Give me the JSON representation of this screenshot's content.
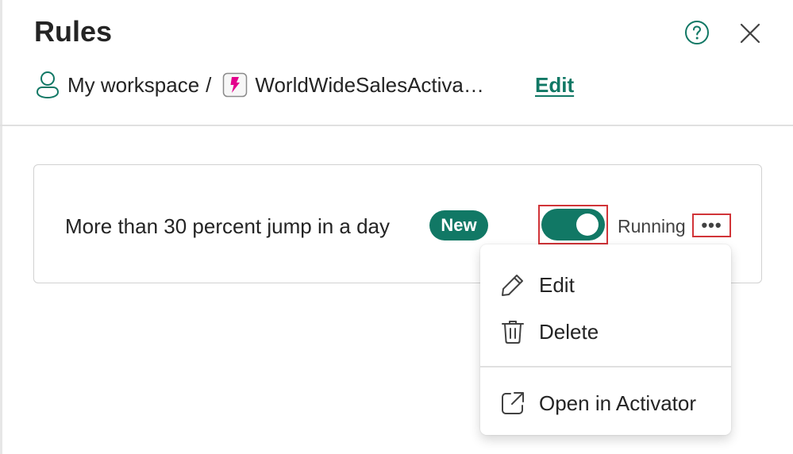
{
  "panel": {
    "title": "Rules",
    "help_icon": "question-circle-icon",
    "close_icon": "close-icon"
  },
  "breadcrumb": {
    "workspace_icon": "person-icon",
    "workspace": "My workspace",
    "separator": "/",
    "item_icon": "activator-icon",
    "item": "WorldWideSalesActiva…",
    "edit_label": "Edit"
  },
  "rule": {
    "name": "More than 30 percent jump in a day",
    "badge": "New",
    "toggle_on": true,
    "status": "Running",
    "more_icon": "more-horizontal-icon",
    "more_label": "•••"
  },
  "context_menu": {
    "items": [
      {
        "label": "Edit",
        "icon": "pencil-icon"
      },
      {
        "label": "Delete",
        "icon": "trash-icon"
      },
      {
        "label": "Open in Activator",
        "icon": "open-external-icon"
      }
    ]
  },
  "colors": {
    "accent": "#117865",
    "highlight": "#d13438",
    "activator_pink": "#e3008c"
  }
}
